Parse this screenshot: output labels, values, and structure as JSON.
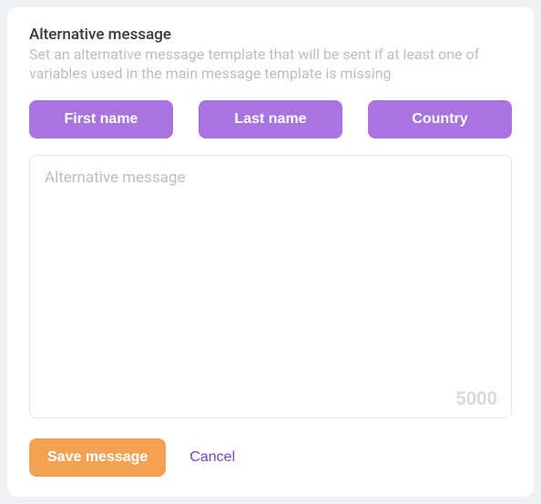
{
  "header": {
    "title": "Alternative message",
    "description": "Set an alternative message template that will be sent if at least one of variables used in the main message template is missing"
  },
  "variables": {
    "first_name": "First name",
    "last_name": "Last name",
    "country": "Country"
  },
  "message": {
    "placeholder": "Alternative message",
    "value": "",
    "char_limit": "5000"
  },
  "actions": {
    "save_label": "Save message",
    "cancel_label": "Cancel"
  }
}
